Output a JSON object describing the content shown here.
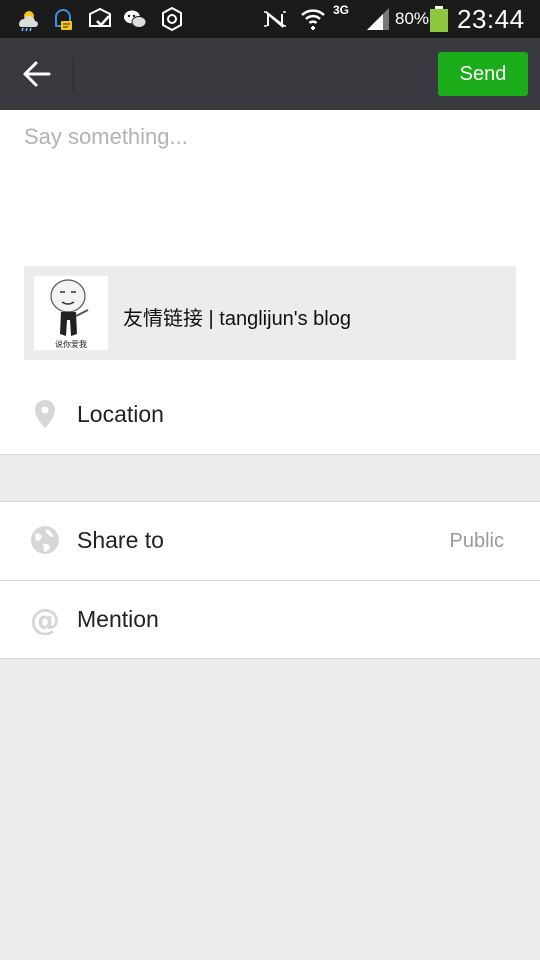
{
  "status_bar": {
    "network": "3G",
    "battery_percent": "80%",
    "time": "23:44",
    "icons": [
      "weather-icon",
      "notification-icon",
      "mail-check-icon",
      "wechat-icon",
      "sync-icon",
      "nfc-off-icon",
      "wifi-icon",
      "signal-icon",
      "battery-icon"
    ]
  },
  "toolbar": {
    "back_icon": "arrow-left-icon",
    "send_label": "Send",
    "send_color": "#1aad19"
  },
  "compose": {
    "placeholder": "Say something...",
    "value": ""
  },
  "link_card": {
    "thumbnail_caption": "说你爱我",
    "title": "友情链接 | tanglijun's blog"
  },
  "options": {
    "location": {
      "label": "Location",
      "icon": "location-pin-icon"
    },
    "share_to": {
      "label": "Share to",
      "value": "Public",
      "icon": "globe-icon"
    },
    "mention": {
      "label": "Mention",
      "icon": "at-icon"
    }
  }
}
